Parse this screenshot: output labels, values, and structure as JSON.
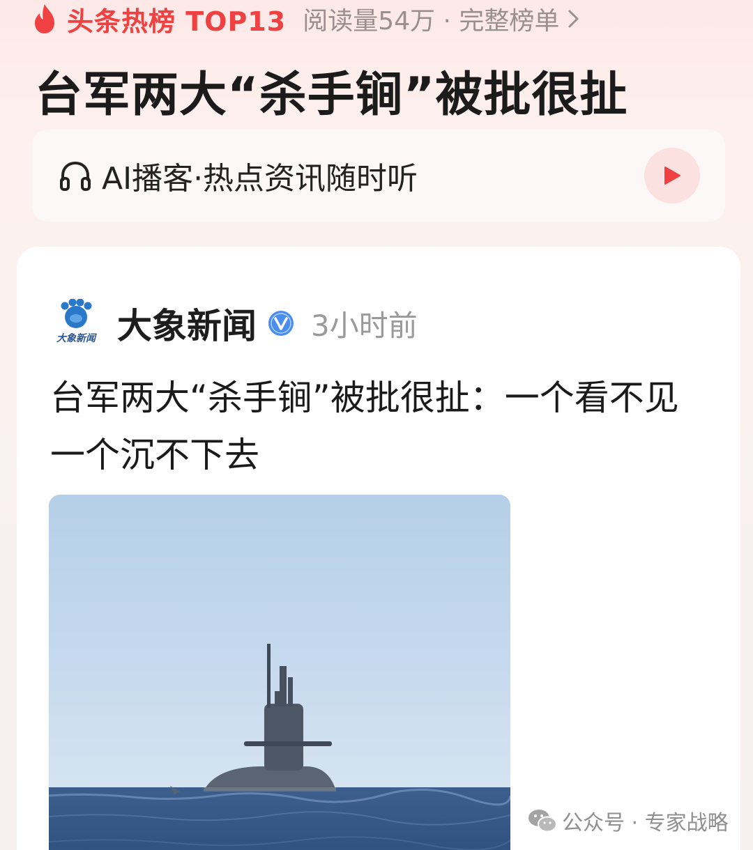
{
  "header": {
    "hot_label": "头条热榜 TOP13",
    "meta": "阅读量54万 · 完整榜单",
    "flame_icon": "flame-icon",
    "chevron_icon": "chevron-right-icon"
  },
  "topic": {
    "title": "台军两大“杀手锏”被批很扯"
  },
  "ai_bar": {
    "icon": "headphone-icon",
    "label": "AI播客·热点资讯随时听",
    "play_icon": "play-icon"
  },
  "article": {
    "source_name": "大象新闻",
    "source_logo_text": "大象新闻",
    "verified_icon": "verified-v-icon",
    "time": "3小时前",
    "title": "台军两大“杀手锏”被批很扯：一个看不见一个沉不下去",
    "image": "submarine-photo"
  },
  "watermark": {
    "icon": "wechat-icon",
    "text": "公众号 · 专家战略"
  },
  "colors": {
    "accent_red": "#f04142",
    "background_top": "#fde9e7",
    "card_background": "#ffffff",
    "verified_blue": "#4a8df0",
    "logo_blue": "#2a78c9"
  }
}
